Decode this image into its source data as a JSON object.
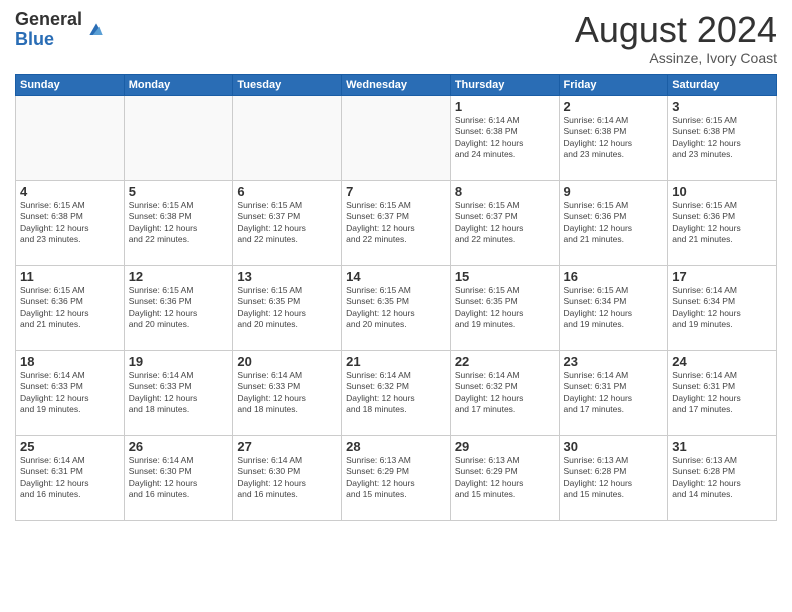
{
  "header": {
    "logo_general": "General",
    "logo_blue": "Blue",
    "month_title": "August 2024",
    "location": "Assinze, Ivory Coast"
  },
  "weekdays": [
    "Sunday",
    "Monday",
    "Tuesday",
    "Wednesday",
    "Thursday",
    "Friday",
    "Saturday"
  ],
  "weeks": [
    [
      {
        "day": "",
        "info": ""
      },
      {
        "day": "",
        "info": ""
      },
      {
        "day": "",
        "info": ""
      },
      {
        "day": "",
        "info": ""
      },
      {
        "day": "1",
        "info": "Sunrise: 6:14 AM\nSunset: 6:38 PM\nDaylight: 12 hours\nand 24 minutes."
      },
      {
        "day": "2",
        "info": "Sunrise: 6:14 AM\nSunset: 6:38 PM\nDaylight: 12 hours\nand 23 minutes."
      },
      {
        "day": "3",
        "info": "Sunrise: 6:15 AM\nSunset: 6:38 PM\nDaylight: 12 hours\nand 23 minutes."
      }
    ],
    [
      {
        "day": "4",
        "info": "Sunrise: 6:15 AM\nSunset: 6:38 PM\nDaylight: 12 hours\nand 23 minutes."
      },
      {
        "day": "5",
        "info": "Sunrise: 6:15 AM\nSunset: 6:38 PM\nDaylight: 12 hours\nand 22 minutes."
      },
      {
        "day": "6",
        "info": "Sunrise: 6:15 AM\nSunset: 6:37 PM\nDaylight: 12 hours\nand 22 minutes."
      },
      {
        "day": "7",
        "info": "Sunrise: 6:15 AM\nSunset: 6:37 PM\nDaylight: 12 hours\nand 22 minutes."
      },
      {
        "day": "8",
        "info": "Sunrise: 6:15 AM\nSunset: 6:37 PM\nDaylight: 12 hours\nand 22 minutes."
      },
      {
        "day": "9",
        "info": "Sunrise: 6:15 AM\nSunset: 6:36 PM\nDaylight: 12 hours\nand 21 minutes."
      },
      {
        "day": "10",
        "info": "Sunrise: 6:15 AM\nSunset: 6:36 PM\nDaylight: 12 hours\nand 21 minutes."
      }
    ],
    [
      {
        "day": "11",
        "info": "Sunrise: 6:15 AM\nSunset: 6:36 PM\nDaylight: 12 hours\nand 21 minutes."
      },
      {
        "day": "12",
        "info": "Sunrise: 6:15 AM\nSunset: 6:36 PM\nDaylight: 12 hours\nand 20 minutes."
      },
      {
        "day": "13",
        "info": "Sunrise: 6:15 AM\nSunset: 6:35 PM\nDaylight: 12 hours\nand 20 minutes."
      },
      {
        "day": "14",
        "info": "Sunrise: 6:15 AM\nSunset: 6:35 PM\nDaylight: 12 hours\nand 20 minutes."
      },
      {
        "day": "15",
        "info": "Sunrise: 6:15 AM\nSunset: 6:35 PM\nDaylight: 12 hours\nand 19 minutes."
      },
      {
        "day": "16",
        "info": "Sunrise: 6:15 AM\nSunset: 6:34 PM\nDaylight: 12 hours\nand 19 minutes."
      },
      {
        "day": "17",
        "info": "Sunrise: 6:14 AM\nSunset: 6:34 PM\nDaylight: 12 hours\nand 19 minutes."
      }
    ],
    [
      {
        "day": "18",
        "info": "Sunrise: 6:14 AM\nSunset: 6:33 PM\nDaylight: 12 hours\nand 19 minutes."
      },
      {
        "day": "19",
        "info": "Sunrise: 6:14 AM\nSunset: 6:33 PM\nDaylight: 12 hours\nand 18 minutes."
      },
      {
        "day": "20",
        "info": "Sunrise: 6:14 AM\nSunset: 6:33 PM\nDaylight: 12 hours\nand 18 minutes."
      },
      {
        "day": "21",
        "info": "Sunrise: 6:14 AM\nSunset: 6:32 PM\nDaylight: 12 hours\nand 18 minutes."
      },
      {
        "day": "22",
        "info": "Sunrise: 6:14 AM\nSunset: 6:32 PM\nDaylight: 12 hours\nand 17 minutes."
      },
      {
        "day": "23",
        "info": "Sunrise: 6:14 AM\nSunset: 6:31 PM\nDaylight: 12 hours\nand 17 minutes."
      },
      {
        "day": "24",
        "info": "Sunrise: 6:14 AM\nSunset: 6:31 PM\nDaylight: 12 hours\nand 17 minutes."
      }
    ],
    [
      {
        "day": "25",
        "info": "Sunrise: 6:14 AM\nSunset: 6:31 PM\nDaylight: 12 hours\nand 16 minutes."
      },
      {
        "day": "26",
        "info": "Sunrise: 6:14 AM\nSunset: 6:30 PM\nDaylight: 12 hours\nand 16 minutes."
      },
      {
        "day": "27",
        "info": "Sunrise: 6:14 AM\nSunset: 6:30 PM\nDaylight: 12 hours\nand 16 minutes."
      },
      {
        "day": "28",
        "info": "Sunrise: 6:13 AM\nSunset: 6:29 PM\nDaylight: 12 hours\nand 15 minutes."
      },
      {
        "day": "29",
        "info": "Sunrise: 6:13 AM\nSunset: 6:29 PM\nDaylight: 12 hours\nand 15 minutes."
      },
      {
        "day": "30",
        "info": "Sunrise: 6:13 AM\nSunset: 6:28 PM\nDaylight: 12 hours\nand 15 minutes."
      },
      {
        "day": "31",
        "info": "Sunrise: 6:13 AM\nSunset: 6:28 PM\nDaylight: 12 hours\nand 14 minutes."
      }
    ]
  ]
}
